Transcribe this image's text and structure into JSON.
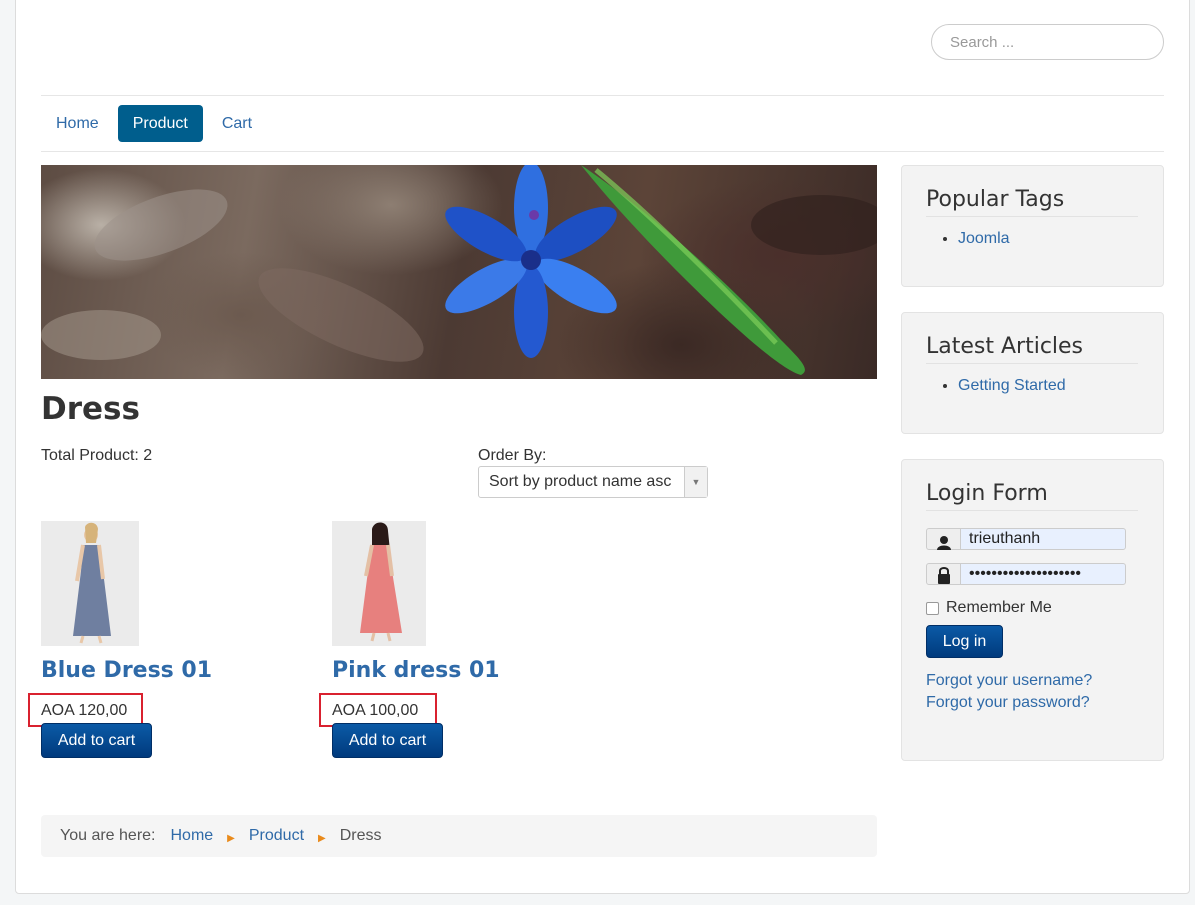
{
  "search": {
    "placeholder": "Search ..."
  },
  "nav": {
    "items": [
      {
        "label": "Home"
      },
      {
        "label": "Product"
      },
      {
        "label": "Cart"
      }
    ],
    "active": "Product"
  },
  "category": {
    "title": "Dress",
    "total_label": "Total Product: 2",
    "order_by_label": "Order By:",
    "order_by_selected": "Sort by product name asc"
  },
  "products": [
    {
      "title": "Blue Dress 01",
      "price": "AOA 120,00",
      "cart_label": "Add to cart"
    },
    {
      "title": "Pink dress 01",
      "price": "AOA 100,00",
      "cart_label": "Add to cart"
    }
  ],
  "breadcrumb": {
    "label": "You are here:",
    "items": [
      "Home",
      "Product"
    ],
    "current": "Dress"
  },
  "sidebar": {
    "popular_tags": {
      "title": "Popular Tags",
      "items": [
        "Joomla"
      ]
    },
    "latest_articles": {
      "title": "Latest Articles",
      "items": [
        "Getting Started"
      ]
    },
    "login": {
      "title": "Login Form",
      "username": "trieuthanh",
      "password": "••••••••••••••••••••",
      "remember_label": "Remember Me",
      "login_label": "Log in",
      "forgot_username": "Forgot your username?",
      "forgot_password": "Forgot your password?"
    }
  },
  "colors": {
    "accent": "#005e8d",
    "link": "#2f6aa8",
    "button": "#003a7d",
    "highlight_box": "#d9212f",
    "breadcrumb_sep": "#e98a1b"
  }
}
